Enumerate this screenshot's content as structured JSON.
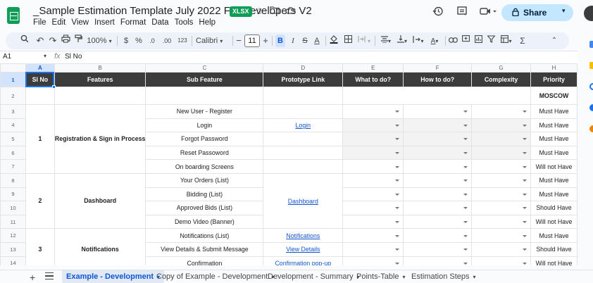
{
  "doc": {
    "title": "_Sample Estimation Template July 2022 For Developers V2",
    "badge": "XLSX"
  },
  "menu": [
    "File",
    "Edit",
    "View",
    "Insert",
    "Format",
    "Data",
    "Tools",
    "Help"
  ],
  "share": {
    "label": "Share"
  },
  "toolbar": {
    "zoom": "100%",
    "currency": "$",
    "percent": "%",
    "dec_decrease": ".0",
    "dec_increase": ".00",
    "number_format": "123",
    "font": "Calibri",
    "font_size": "11",
    "bold": "B",
    "italic": "I",
    "strike": "S",
    "text_color": "A",
    "sum": "Σ"
  },
  "formula_bar": {
    "cell_ref": "A1",
    "fx": "fx",
    "value": "Sl No"
  },
  "grid": {
    "columns": [
      "A",
      "B",
      "C",
      "D",
      "E",
      "F",
      "G",
      "H"
    ],
    "headers": [
      "Sl No",
      "Features",
      "Sub Feature",
      "Prototype Link",
      "What to do?",
      "How to do?",
      "Complexity",
      "Priority"
    ],
    "row_numbers": [
      "1",
      "2",
      "3",
      "4",
      "5",
      "6",
      "7",
      "8",
      "9",
      "10",
      "11",
      "12",
      "13",
      "14"
    ],
    "row2_priority": "MOSCOW",
    "groups": [
      {
        "num": "1",
        "feature": "Registration & Sign in Process"
      },
      {
        "num": "2",
        "feature": "Dashboard"
      },
      {
        "num": "3",
        "feature": "Notifications"
      }
    ],
    "rows": [
      {
        "sub": "New User - Register",
        "link": "",
        "priority": "Must Have"
      },
      {
        "sub": "Login",
        "link": "Login",
        "priority": "Must Have"
      },
      {
        "sub": "Forgot Password",
        "link": "",
        "priority": "Must Have"
      },
      {
        "sub": "Reset Passoword",
        "link": "",
        "priority": "Must Have"
      },
      {
        "sub": "On boarding Screens",
        "link": "",
        "priority": "Will not Have"
      },
      {
        "sub": "Your Orders (List)",
        "link": "",
        "priority": "Must Have"
      },
      {
        "sub": "Bidding (List)",
        "link": "Dashboard",
        "priority": "Must Have"
      },
      {
        "sub": "Approved Bids (List)",
        "link": "",
        "priority": "Should Have"
      },
      {
        "sub": "Demo Video (Banner)",
        "link": "",
        "priority": "Will not Have"
      },
      {
        "sub": "Notifications (List)",
        "link": "Notifications",
        "priority": "Must Have"
      },
      {
        "sub": "View Details & Submit Message",
        "link": "View Details",
        "priority": "Should Have"
      },
      {
        "sub": "Confirmation",
        "link": "Confirmation pop-up",
        "priority": "Will not Have"
      }
    ]
  },
  "sheets": [
    {
      "label": "Example - Development",
      "active": true
    },
    {
      "label": "Copy of Example - Development",
      "active": false
    },
    {
      "label": "Development - Summary",
      "active": false
    },
    {
      "label": "Points-Table",
      "active": false
    },
    {
      "label": "Estimation Steps",
      "active": false
    }
  ],
  "colors": {
    "accent": "#0b57d0",
    "sheets_green": "#0f9d58",
    "header_dark": "#3c3c3c",
    "share_bg": "#c2e7ff",
    "link": "#1155cc"
  },
  "icons": [
    "sheets-logo-icon",
    "star-icon",
    "folder-icon",
    "cloud-icon",
    "history-icon",
    "comment-icon",
    "video-call-icon",
    "lock-icon",
    "search-icon",
    "undo-icon",
    "redo-icon",
    "print-icon",
    "paint-format-icon",
    "borders-icon",
    "merge-icon",
    "align-icon",
    "link-icon",
    "filter-icon",
    "chevron-up-icon"
  ]
}
